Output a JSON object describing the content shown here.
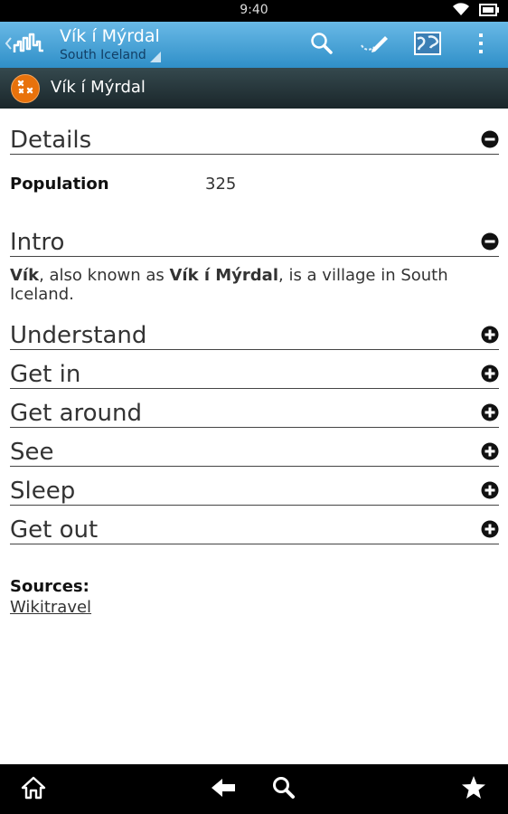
{
  "status_bar": {
    "time": "9:40"
  },
  "action_bar": {
    "title": "Vík í Mýrdal",
    "subtitle": "South Iceland",
    "icons": [
      "back-icon",
      "app-logo-icon",
      "search-icon",
      "edit-route-icon",
      "map-icon",
      "overflow-menu-icon"
    ]
  },
  "title_bar": {
    "title": "Vík í Mýrdal",
    "badge_icon": "city-marker-icon"
  },
  "details": {
    "heading": "Details",
    "population_label": "Population",
    "population_value": "325"
  },
  "intro": {
    "heading": "Intro",
    "text_parts": [
      "Vík",
      ", also known as ",
      "Vík í Mýrdal",
      ", is a village in South Iceland."
    ]
  },
  "sections": [
    {
      "label": "Understand"
    },
    {
      "label": "Get in"
    },
    {
      "label": "Get around"
    },
    {
      "label": "See"
    },
    {
      "label": "Sleep"
    },
    {
      "label": "Get out"
    }
  ],
  "sources": {
    "label": "Sources:",
    "link": "Wikitravel"
  },
  "bottom_nav": {
    "icons": [
      "home-icon",
      "back-arrow-icon",
      "search-icon",
      "star-icon"
    ]
  },
  "colors": {
    "action_bar": "#2f8fc8",
    "title_bar": "#1a262a",
    "badge": "#e8720c",
    "divider": "#444444"
  }
}
